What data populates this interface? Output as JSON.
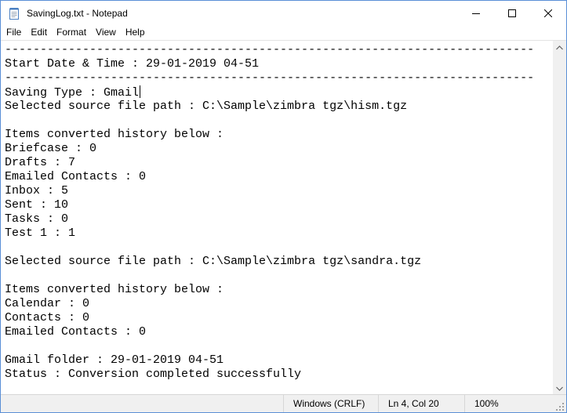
{
  "window": {
    "title": "SavingLog.txt - Notepad",
    "icon": "notepad-icon",
    "controls": [
      "minimize-icon",
      "maximize-icon",
      "close-icon"
    ]
  },
  "menu": {
    "items": [
      "File",
      "Edit",
      "Format",
      "View",
      "Help"
    ]
  },
  "document": {
    "lines": [
      "---------------------------------------------------------------------------",
      "Start Date & Time : 29-01-2019 04-51",
      "---------------------------------------------------------------------------",
      "Saving Type : Gmail",
      "Selected source file path : C:\\Sample\\zimbra tgz\\hism.tgz",
      "",
      "Items converted history below :",
      "Briefcase : 0",
      "Drafts : 7",
      "Emailed Contacts : 0",
      "Inbox : 5",
      "Sent : 10",
      "Tasks : 0",
      "Test 1 : 1",
      "",
      "Selected source file path : C:\\Sample\\zimbra tgz\\sandra.tgz",
      "",
      "Items converted history below :",
      "Calendar : 0",
      "Contacts : 0",
      "Emailed Contacts : 0",
      "",
      "Gmail folder : 29-01-2019 04-51",
      "Status : Conversion completed successfully"
    ],
    "caret_line": 4
  },
  "status": {
    "line_ending": "Windows (CRLF)",
    "position": "Ln 4, Col 20",
    "zoom": "100%"
  },
  "colors": {
    "window_border": "#5a8fd6",
    "statusbar_bg": "#f0f0f0",
    "scrollbar_bg": "#f0f0f0"
  }
}
